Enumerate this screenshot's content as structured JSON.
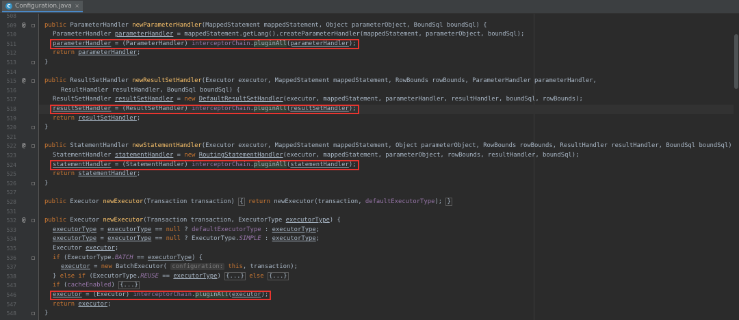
{
  "tab": {
    "filename": "Configuration.java",
    "close": "×"
  },
  "colors": {
    "highlight_box": "#e8352f",
    "keyword": "#cc7832",
    "method": "#ffc66d",
    "field": "#9876aa"
  },
  "lines": [
    {
      "n": "508",
      "tokens": []
    },
    {
      "n": "509",
      "anno": "@",
      "fold": true,
      "tokens": [
        [
          "kw",
          "public "
        ],
        [
          "",
          "ParameterHandler "
        ],
        [
          "fn",
          "newParameterHandler"
        ],
        [
          "",
          "(MappedStatement mappedStatement, Object parameterObject, BoundSql boundSql) {"
        ]
      ]
    },
    {
      "n": "510",
      "indent": 1,
      "tokens": [
        [
          "",
          "ParameterHandler "
        ],
        [
          "ul",
          "parameterHandler"
        ],
        [
          "",
          " = mappedStatement.getLang().createParameterHandler(mappedStatement, parameterObject, boundSql);"
        ]
      ]
    },
    {
      "n": "511",
      "indent": 1,
      "box": true,
      "tokens": [
        [
          "ul",
          "parameterHandler"
        ],
        [
          "",
          " = (ParameterHandler) "
        ],
        [
          "fld",
          "interceptorChain"
        ],
        [
          "",
          "."
        ],
        [
          "pm",
          "pluginAll"
        ],
        [
          "",
          "("
        ],
        [
          "ul",
          "parameterHandler"
        ],
        [
          "",
          ");"
        ]
      ]
    },
    {
      "n": "512",
      "indent": 1,
      "tokens": [
        [
          "kw",
          "return "
        ],
        [
          "ul",
          "parameterHandler"
        ],
        [
          "",
          ";"
        ]
      ]
    },
    {
      "n": "513",
      "fold": true,
      "tokens": [
        [
          "",
          "}"
        ]
      ]
    },
    {
      "n": "514",
      "tokens": []
    },
    {
      "n": "515",
      "anno": "@",
      "fold": true,
      "tokens": [
        [
          "kw",
          "public "
        ],
        [
          "",
          "ResultSetHandler "
        ],
        [
          "fn",
          "newResultSetHandler"
        ],
        [
          "",
          "(Executor executor, MappedStatement mappedStatement, RowBounds rowBounds, ParameterHandler parameterHandler,"
        ]
      ]
    },
    {
      "n": "516",
      "indent": 2,
      "tokens": [
        [
          "",
          "ResultHandler resultHandler, BoundSql boundSql) {"
        ]
      ]
    },
    {
      "n": "517",
      "indent": 1,
      "tokens": [
        [
          "",
          "ResultSetHandler "
        ],
        [
          "ul",
          "resultSetHandler"
        ],
        [
          "",
          " = "
        ],
        [
          "kw",
          "new "
        ],
        [
          "ul",
          "DefaultResultSetHandler"
        ],
        [
          "",
          "(executor, mappedStatement, parameterHandler, resultHandler, boundSql, rowBounds);"
        ]
      ]
    },
    {
      "n": "518",
      "indent": 1,
      "box": true,
      "current": true,
      "tokens": [
        [
          "ul",
          "resultSetHandler"
        ],
        [
          "",
          " = (ResultSetHandler) "
        ],
        [
          "fld",
          "interceptorChain"
        ],
        [
          "",
          "."
        ],
        [
          "pm",
          "pluginAll"
        ],
        [
          "",
          "("
        ],
        [
          "ul",
          "resultSetHandler"
        ],
        [
          "",
          ");"
        ]
      ]
    },
    {
      "n": "519",
      "indent": 1,
      "tokens": [
        [
          "kw",
          "return "
        ],
        [
          "ul",
          "resultSetHandler"
        ],
        [
          "",
          ";"
        ]
      ]
    },
    {
      "n": "520",
      "fold": true,
      "tokens": [
        [
          "",
          "}"
        ]
      ]
    },
    {
      "n": "521",
      "tokens": []
    },
    {
      "n": "522",
      "anno": "@",
      "fold": true,
      "tokens": [
        [
          "kw",
          "public "
        ],
        [
          "",
          "StatementHandler "
        ],
        [
          "fn",
          "newStatementHandler"
        ],
        [
          "",
          "(Executor executor, MappedStatement mappedStatement, Object parameterObject, RowBounds rowBounds, ResultHandler resultHandler, BoundSql boundSql) {"
        ]
      ]
    },
    {
      "n": "523",
      "indent": 1,
      "tokens": [
        [
          "",
          "StatementHandler "
        ],
        [
          "ul",
          "statementHandler"
        ],
        [
          "",
          " = "
        ],
        [
          "kw",
          "new "
        ],
        [
          "ul",
          "RoutingStatementHandler"
        ],
        [
          "",
          "(executor, mappedStatement, parameterObject, rowBounds, resultHandler, boundSql);"
        ]
      ]
    },
    {
      "n": "524",
      "indent": 1,
      "box": true,
      "tokens": [
        [
          "ul",
          "statementHandler"
        ],
        [
          "",
          " = (StatementHandler) "
        ],
        [
          "fld",
          "interceptorChain"
        ],
        [
          "",
          "."
        ],
        [
          "pm",
          "pluginAll"
        ],
        [
          "",
          "("
        ],
        [
          "ul",
          "statementHandler"
        ],
        [
          "",
          ");"
        ]
      ]
    },
    {
      "n": "525",
      "indent": 1,
      "tokens": [
        [
          "kw",
          "return "
        ],
        [
          "ul",
          "statementHandler"
        ],
        [
          "",
          ";"
        ]
      ]
    },
    {
      "n": "526",
      "fold": true,
      "tokens": [
        [
          "",
          "}"
        ]
      ]
    },
    {
      "n": "527",
      "tokens": []
    },
    {
      "n": "528",
      "tokens": [
        [
          "kw",
          "public "
        ],
        [
          "",
          "Executor "
        ],
        [
          "fn",
          "newExecutor"
        ],
        [
          "",
          "(Transaction transaction) "
        ],
        [
          "foldbox",
          "{"
        ],
        [
          "",
          " "
        ],
        [
          "kw",
          "return "
        ],
        [
          "",
          "newExecutor(transaction, "
        ],
        [
          "fld",
          "defaultExecutorType"
        ],
        [
          "",
          "); "
        ],
        [
          "foldbox",
          "}"
        ]
      ]
    },
    {
      "n": "531",
      "tokens": []
    },
    {
      "n": "532",
      "anno": "@",
      "fold": true,
      "tokens": [
        [
          "kw",
          "public "
        ],
        [
          "",
          "Executor "
        ],
        [
          "fn",
          "newExecutor"
        ],
        [
          "",
          "(Transaction transaction, ExecutorType "
        ],
        [
          "ul",
          "executorType"
        ],
        [
          "",
          ") {"
        ]
      ]
    },
    {
      "n": "533",
      "indent": 1,
      "tokens": [
        [
          "ul",
          "executorType"
        ],
        [
          "",
          " = "
        ],
        [
          "ul",
          "executorType"
        ],
        [
          "",
          " == "
        ],
        [
          "kw",
          "null "
        ],
        [
          "",
          "? "
        ],
        [
          "fld",
          "defaultExecutorType"
        ],
        [
          "",
          " : "
        ],
        [
          "ul",
          "executorType"
        ],
        [
          "",
          ";"
        ]
      ]
    },
    {
      "n": "534",
      "indent": 1,
      "tokens": [
        [
          "ul",
          "executorType"
        ],
        [
          "",
          " = "
        ],
        [
          "ul",
          "executorType"
        ],
        [
          "",
          " == "
        ],
        [
          "kw",
          "null "
        ],
        [
          "",
          "? ExecutorType."
        ],
        [
          "fld it",
          "SIMPLE"
        ],
        [
          "",
          " : "
        ],
        [
          "ul",
          "executorType"
        ],
        [
          "",
          ";"
        ]
      ]
    },
    {
      "n": "535",
      "indent": 1,
      "tokens": [
        [
          "",
          "Executor "
        ],
        [
          "ul",
          "executor"
        ],
        [
          "",
          ";"
        ]
      ]
    },
    {
      "n": "536",
      "indent": 1,
      "fold": true,
      "tokens": [
        [
          "kw",
          "if "
        ],
        [
          "",
          "(ExecutorType."
        ],
        [
          "fld it",
          "BATCH"
        ],
        [
          "",
          " == "
        ],
        [
          "ul",
          "executorType"
        ],
        [
          "",
          ") {"
        ]
      ]
    },
    {
      "n": "537",
      "indent": 2,
      "tokens": [
        [
          "ul",
          "executor"
        ],
        [
          "",
          " = "
        ],
        [
          "kw",
          "new "
        ],
        [
          "",
          "BatchExecutor( "
        ],
        [
          "hint",
          "configuration:"
        ],
        [
          "",
          " "
        ],
        [
          "kw",
          "this"
        ],
        [
          "",
          ", transaction);"
        ]
      ]
    },
    {
      "n": "538",
      "indent": 1,
      "tokens": [
        [
          "",
          "} "
        ],
        [
          "kw",
          "else if "
        ],
        [
          "",
          "(ExecutorType."
        ],
        [
          "fld it",
          "REUSE"
        ],
        [
          "",
          " == "
        ],
        [
          "ul",
          "executorType"
        ],
        [
          "",
          ") "
        ],
        [
          "foldbox",
          "{...}"
        ],
        [
          "",
          " "
        ],
        [
          "kw",
          "else "
        ],
        [
          "foldbox",
          "{...}"
        ]
      ]
    },
    {
      "n": "543",
      "indent": 1,
      "tokens": [
        [
          "kw",
          "if "
        ],
        [
          "",
          "("
        ],
        [
          "fld",
          "cacheEnabled"
        ],
        [
          "",
          ") "
        ],
        [
          "foldbox",
          "{...}"
        ]
      ]
    },
    {
      "n": "546",
      "indent": 1,
      "box": true,
      "tokens": [
        [
          "ul",
          "executor"
        ],
        [
          "",
          " = (Executor) "
        ],
        [
          "fld",
          "interceptorChain"
        ],
        [
          "",
          "."
        ],
        [
          "pm",
          "pluginAll"
        ],
        [
          "",
          "("
        ],
        [
          "ul",
          "executor"
        ],
        [
          "",
          ");"
        ]
      ]
    },
    {
      "n": "547",
      "indent": 1,
      "tokens": [
        [
          "kw",
          "return "
        ],
        [
          "ul",
          "executor"
        ],
        [
          "",
          ";"
        ]
      ]
    },
    {
      "n": "548",
      "fold": true,
      "tokens": [
        [
          "",
          "}"
        ]
      ]
    }
  ]
}
